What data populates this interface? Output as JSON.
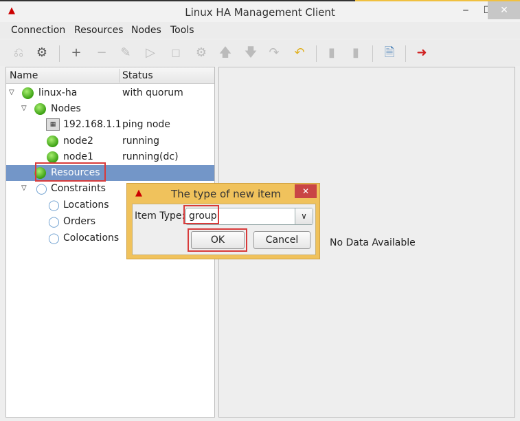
{
  "window": {
    "title": "Linux HA Management Client",
    "logo": "linux-ha-logo",
    "minimize": "‒",
    "maximize": "☐",
    "close": "✕"
  },
  "menu": [
    "Connection",
    "Resources",
    "Nodes",
    "Tools"
  ],
  "toolbar": [
    "disconnect-icon",
    "connect-icon",
    "add-icon",
    "remove-icon",
    "cleanup-icon",
    "start-icon",
    "stop-icon",
    "migrate-icon",
    "up-icon",
    "down-icon",
    "redo-icon",
    "undo-icon",
    "standby-icon",
    "active-icon",
    "view-icon",
    "exit-icon"
  ],
  "tree": {
    "headers": {
      "name": "Name",
      "status": "Status"
    },
    "rows": [
      {
        "name": "linux-ha",
        "status": "with quorum"
      },
      {
        "name": "Nodes",
        "status": ""
      },
      {
        "name": "192.168.1.1",
        "status": "ping node"
      },
      {
        "name": "node2",
        "status": "running"
      },
      {
        "name": "node1",
        "status": "running(dc)"
      },
      {
        "name": "Resources",
        "status": "",
        "selected": true
      },
      {
        "name": "Constraints",
        "status": ""
      },
      {
        "name": "Locations",
        "status": ""
      },
      {
        "name": "Orders",
        "status": ""
      },
      {
        "name": "Colocations",
        "status": ""
      }
    ]
  },
  "right": {
    "empty_text": "No Data Available"
  },
  "dialog": {
    "title": "The type of new item",
    "close": "✕",
    "field_label": "Item Type:",
    "field_value": "group",
    "ok": "OK",
    "cancel": "Cancel"
  },
  "colors": {
    "selection": "#7396c8",
    "dialog": "#f0c25c",
    "highlight": "#d83a3a"
  }
}
